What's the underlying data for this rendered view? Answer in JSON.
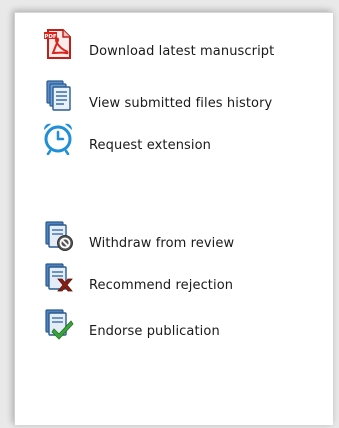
{
  "actions_top": [
    {
      "label": "Download latest manuscript",
      "icon": "pdf-icon"
    },
    {
      "label": "View submitted files history",
      "icon": "files-history-icon"
    },
    {
      "label": "Request extension",
      "icon": "alarm-clock-icon"
    }
  ],
  "actions_bottom": [
    {
      "label": "Withdraw from review",
      "icon": "withdraw-icon"
    },
    {
      "label": "Recommend rejection",
      "icon": "reject-icon"
    },
    {
      "label": "Endorse publication",
      "icon": "endorse-icon"
    }
  ],
  "colors": {
    "pdf_red": "#d9241c",
    "doc_blue": "#3a6ea8",
    "reject_red": "#8b1e12",
    "endorse_green": "#3aa63a"
  }
}
